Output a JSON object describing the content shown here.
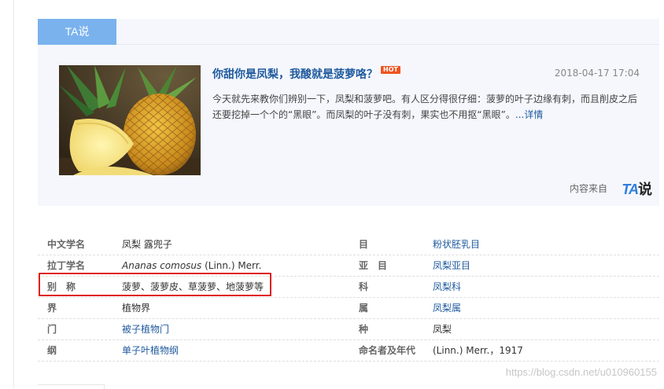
{
  "ta_section": {
    "tab_label": "TA说",
    "article": {
      "title": "你甜你是凤梨，我酸就是菠萝咯？",
      "badge": "HOT",
      "date": "2018-04-17 17:04",
      "summary": "今天就先来教你们辨别一下，凤梨和菠萝吧。有人区分得很仔细：菠萝的叶子边缘有刺，而且削皮之后还要挖掉一个个的“黑眼”。而凤梨的叶子没有刺，果实也不用抠“黑眼”。",
      "more_link": "...详情"
    },
    "source_label": "内容来自",
    "logo_ta": "TA",
    "logo_shuo": "说"
  },
  "info_table": {
    "rows": [
      {
        "k1": "中文学名",
        "v1": "凤梨 露兜子",
        "k2": "目",
        "v2": "粉状胚乳目"
      },
      {
        "k1": "拉丁学名",
        "v1_italic": "Ananas comosus",
        "v1_rest": " (Linn.) Merr.",
        "k2": "亚　目",
        "v2": "凤梨亚目"
      },
      {
        "k1": "别　称",
        "v1": "菠萝、菠萝皮、草菠萝、地菠萝等",
        "k2": "科",
        "v2": "凤梨科"
      },
      {
        "k1": "界",
        "v1": "植物界",
        "k2": "属",
        "v2": "凤梨属"
      },
      {
        "k1": "门",
        "v1": "被子植物门",
        "k2": "种",
        "v2": "凤梨"
      },
      {
        "k1": "纲",
        "v1": "单子叶植物纲",
        "k2": "命名者及年代",
        "v2": "(Linn.) Merr.，1917"
      }
    ]
  },
  "watermark": "https://blog.csdn.net/u010960155",
  "colors": {
    "accent": "#7ab2ee",
    "link": "#1f5a9e",
    "highlight": "#e02020",
    "hot": "#ee5522"
  }
}
